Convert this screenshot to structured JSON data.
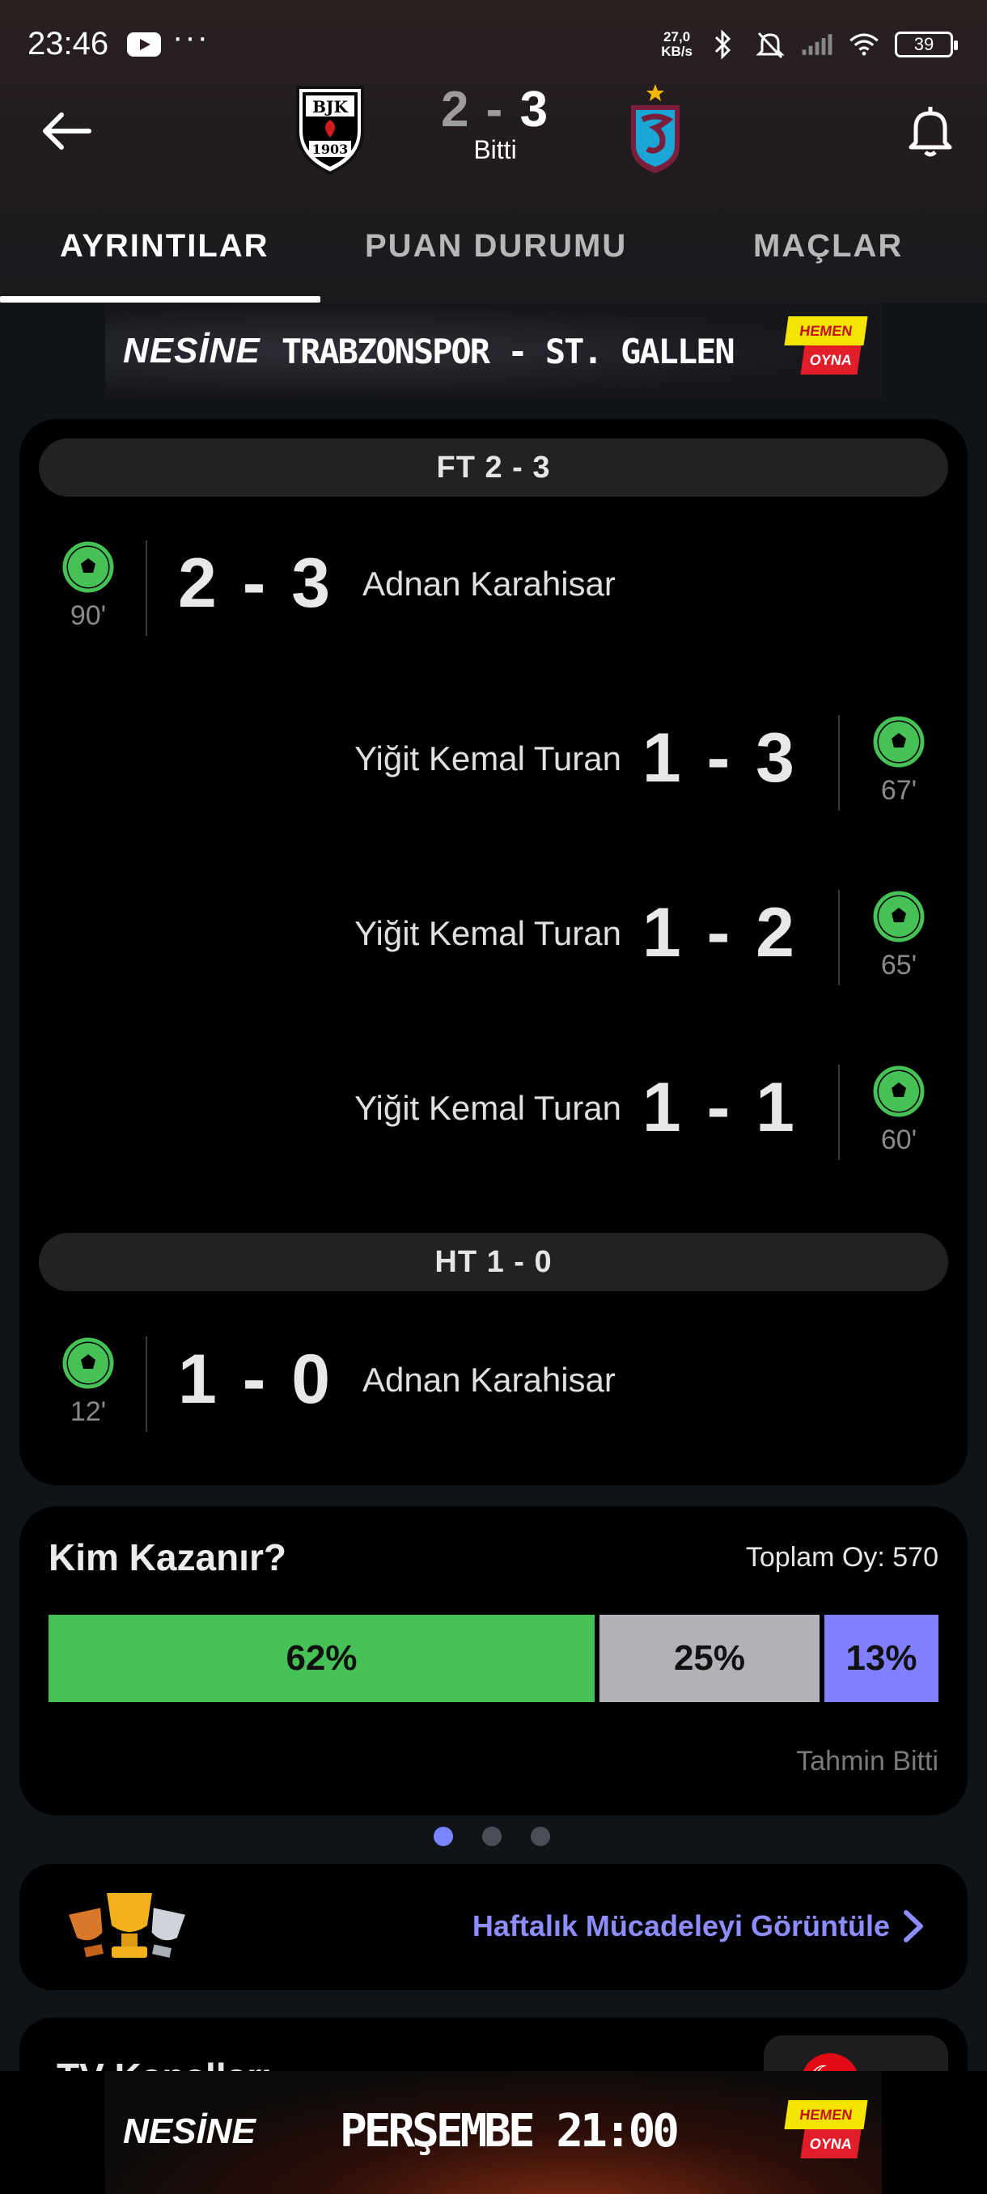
{
  "status_bar": {
    "time": "23:46",
    "dots": "···",
    "net_speed_value": "27,0",
    "net_speed_unit": "KB/s",
    "battery": "39"
  },
  "match": {
    "home_score": "2",
    "separator": "-",
    "away_score": "3",
    "status": "Bitti",
    "home_team_crest": "besiktas-crest",
    "away_team_crest": "trabzonspor-crest"
  },
  "tabs": [
    {
      "label": "AYRINTILAR",
      "active": true
    },
    {
      "label": "PUAN DURUMU",
      "active": false
    },
    {
      "label": "MAÇLAR",
      "active": false
    }
  ],
  "top_ad": {
    "brand": "NESİNE",
    "text": "TRABZONSPOR - ST. GALLEN",
    "badge_top": "HEMEN",
    "badge_bottom": "OYNA"
  },
  "events": {
    "fulltime_label": "FT 2 - 3",
    "halftime_label": "HT 1 - 0",
    "fulltime_events": [
      {
        "side": "home",
        "minute": "90'",
        "score": "2 - 3",
        "player": "Adnan Karahisar"
      },
      {
        "side": "away",
        "minute": "67'",
        "score": "1 - 3",
        "player": "Yiğit Kemal Turan"
      },
      {
        "side": "away",
        "minute": "65'",
        "score": "1 - 2",
        "player": "Yiğit Kemal Turan"
      },
      {
        "side": "away",
        "minute": "60'",
        "score": "1 - 1",
        "player": "Yiğit Kemal Turan"
      }
    ],
    "halftime_events": [
      {
        "side": "home",
        "minute": "12'",
        "score": "1 - 0",
        "player": "Adnan Karahisar"
      }
    ]
  },
  "prediction": {
    "title": "Kim Kazanır?",
    "total_votes": "Toplam Oy: 570",
    "home_pct": 62,
    "draw_pct": 25,
    "away_pct": 13,
    "home_label": "62%",
    "draw_label": "25%",
    "away_label": "13%",
    "footer": "Tahmin Bitti",
    "colors": {
      "home": "#46c156",
      "draw": "#b0b2b7",
      "away": "#8080ff"
    }
  },
  "pager": {
    "count": 3,
    "active": 0
  },
  "weekly": {
    "link_label": "Haftalık Mücadeleyi Görüntüle"
  },
  "tv": {
    "title": "TV Kanalları"
  },
  "bottom_ad": {
    "brand": "NESİNE",
    "text": "PERŞEMBE 21:00",
    "badge_top": "HEMEN",
    "badge_bottom": "OYNA"
  },
  "colors": {
    "goal_icon": "#46c156",
    "accent": "#8d8dff"
  }
}
